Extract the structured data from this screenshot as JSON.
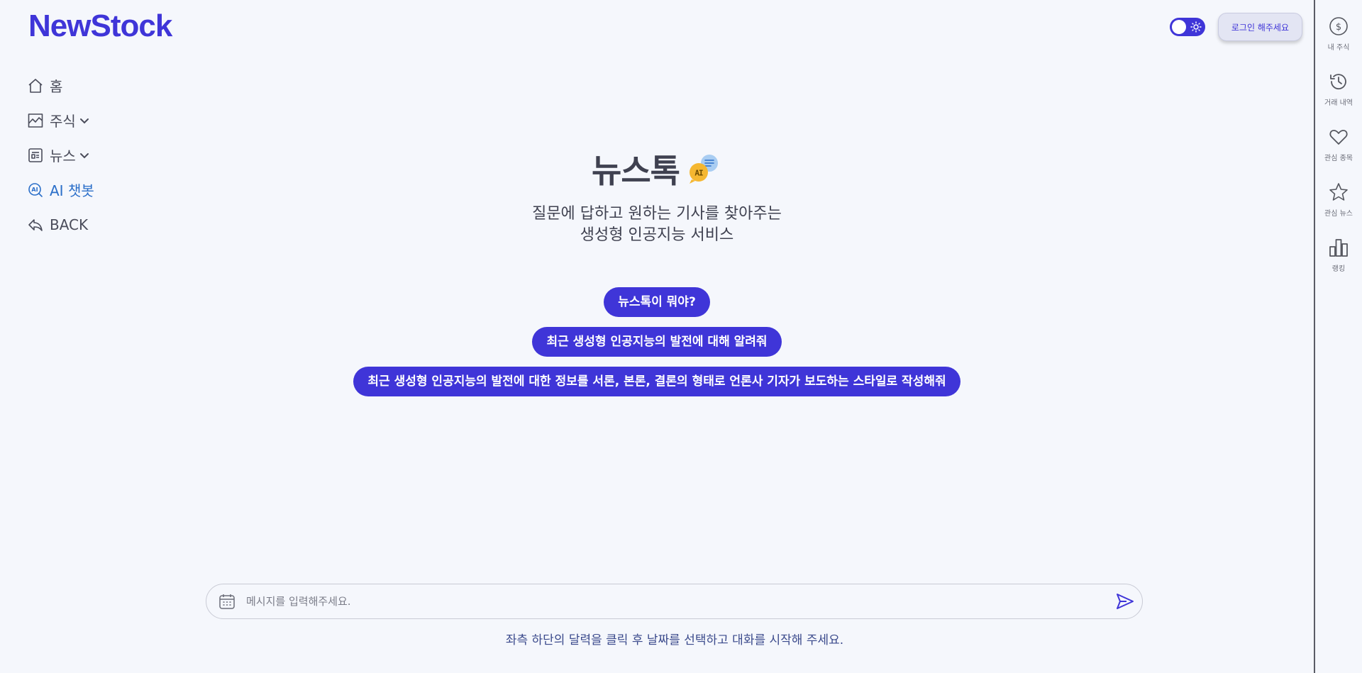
{
  "brand": {
    "logo": "NewStock"
  },
  "nav": [
    {
      "label": "홈",
      "icon": "home-icon"
    },
    {
      "label": "주식",
      "icon": "chart-icon"
    },
    {
      "label": "뉴스",
      "icon": "newspaper-icon"
    },
    {
      "label": "AI 챗봇",
      "icon": "ai-search-icon"
    },
    {
      "label": "BACK",
      "icon": "reply-icon"
    }
  ],
  "header": {
    "login_label": "로그인 해주세요"
  },
  "right_bar": [
    {
      "label": "내 주식",
      "icon": "dollar-coin-icon"
    },
    {
      "label": "거래 내역",
      "icon": "history-icon"
    },
    {
      "label": "관심 종목",
      "icon": "heart-icon"
    },
    {
      "label": "관심 뉴스",
      "icon": "star-icon"
    },
    {
      "label": "랭킹",
      "icon": "bar-chart-icon"
    }
  ],
  "hero": {
    "title": "뉴스톡",
    "badge_text": "AI",
    "subtitle_line1": "질문에 답하고 원하는 기사를 찾아주는",
    "subtitle_line2": "생성형 인공지능 서비스"
  },
  "suggestions": [
    "뉴스톡이 뭐야?",
    "최근 생성형 인공지능의 발전에 대해 알려줘",
    "최근 생성형 인공지능의 발전에 대한 정보를 서론, 본론, 결론의 형태로 언론사 기자가 보도하는 스타일로 작성해줘"
  ],
  "chat": {
    "placeholder": "메시지를 입력해주세요.",
    "value": ""
  },
  "hint": "좌측 하단의 달력을 클릭 후 날짜를 선택하고 대화를 시작해 주세요.",
  "colors": {
    "brand": "#3f35d8",
    "background": "#f5f7fc",
    "active_nav": "#2b6fc9",
    "badge_yellow": "#f5b731",
    "badge_blue": "#a9cdf2"
  }
}
